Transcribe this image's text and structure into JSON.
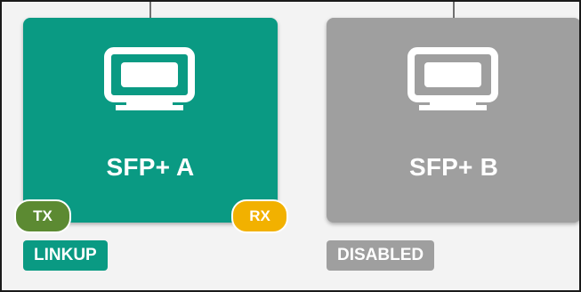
{
  "colors": {
    "active_card": "#0a9a83",
    "disabled_card": "#9f9f9f",
    "tx": "#5c8a32",
    "rx": "#f2b100",
    "linkup_badge": "#0a9a83",
    "disabled_badge": "#9f9f9f",
    "background": "#f3f3f3"
  },
  "ports": [
    {
      "name": "SFP+ A",
      "state": "active",
      "icon": "monitor-icon",
      "tx_label": "TX",
      "rx_label": "RX",
      "status": "LINKUP"
    },
    {
      "name": "SFP+ B",
      "state": "disabled",
      "icon": "monitor-icon",
      "status": "DISABLED"
    }
  ]
}
